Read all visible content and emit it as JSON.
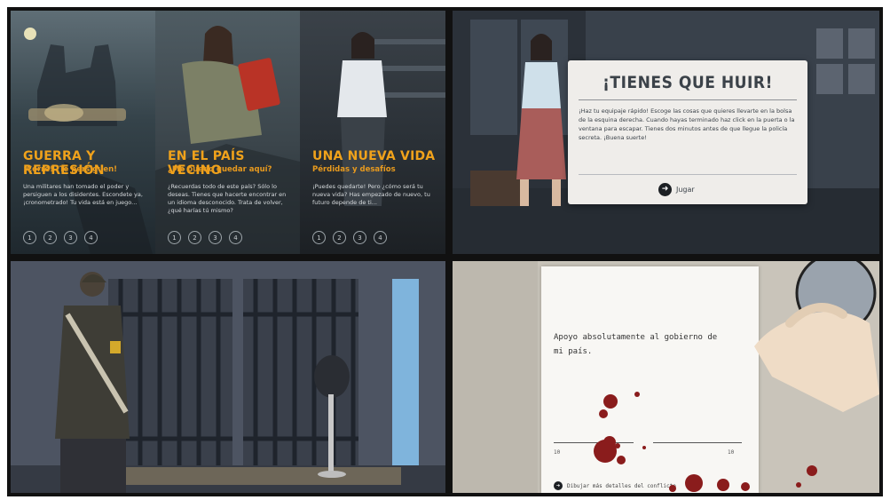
{
  "colors": {
    "accent_orange": "#f0a21b",
    "modal_bg": "#efedea",
    "blood_red": "#8a1c1c"
  },
  "panel1": {
    "columns": [
      {
        "title": "GUERRA Y REPRESIÓN",
        "subtitle": "¡Corre! ¡Te persiguen!",
        "body": "Una militares han tomado el poder y persiguen a los disidentes. Escondete ya, ¡cronometrado! Tu vida está en juego...",
        "steps": [
          "1",
          "2",
          "3",
          "4"
        ]
      },
      {
        "title": "EN EL PAÍS VECINO",
        "subtitle": "¿Me puedo quedar aquí?",
        "body": "¿Recuerdas todo de este país? Sólo lo deseas. Tienes que hacerte encontrar en un idioma desconocido. Trata de volver, ¿qué harías tú mismo?",
        "steps": [
          "1",
          "2",
          "3",
          "4"
        ]
      },
      {
        "title": "UNA NUEVA VIDA",
        "subtitle": "Pérdidas y desafíos",
        "body": "¡Puedes quedarte! Pero ¿cómo será tu nueva vida? Has empezado de nuevo, tu futuro depende de ti...",
        "steps": [
          "1",
          "2",
          "3",
          "4"
        ]
      }
    ]
  },
  "panel2": {
    "modal": {
      "title": "¡TIENES QUE HUIR!",
      "body": "¡Haz tu equipaje rápido! Escoge las cosas que quieres llevarte en la bolsa de la esquina derecha. Cuando hayas terminado haz click en la puerta o la ventana para escapar. Tienes dos minutos antes de que llegue la policía secreta. ¡Buena suerte!",
      "button_label": "Jugar"
    }
  },
  "panel4": {
    "pledge_text": "Apoyo absolutamente al gobierno de mi país.",
    "scale_low": "10",
    "scale_high": "10",
    "link_text": "Dibujar más detalles del conflicto"
  }
}
